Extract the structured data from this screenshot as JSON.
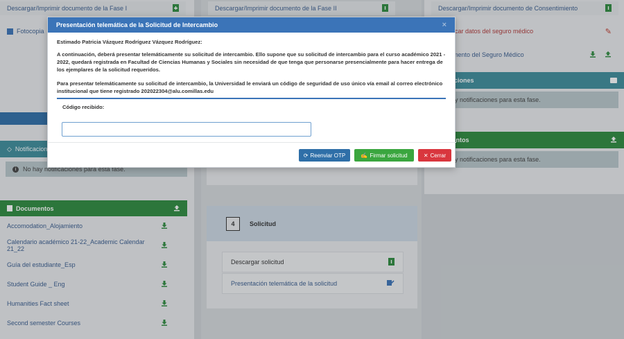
{
  "left_column": {
    "fase1_download": "Descargar/Imprimir documento de la Fase I",
    "fotocopia": "Fotocopia",
    "notifications_header": "Notificaciones",
    "no_notifications": "No hay notificaciones para esta fase.",
    "documents_header": "Documentos",
    "documents": [
      "Accomodation_Alojamiento",
      "Calendario académico 21-22_Academic Calendar 21_22",
      "Guía del estudiante_Esp",
      "Student Guide _ Eng",
      "Humanities Fact sheet",
      "Second semester Courses"
    ]
  },
  "middle_column": {
    "fase2_download": "Descargar/Imprimir documento de la Fase II",
    "step_number": "4",
    "step_title": "Solicitud",
    "download_solicitud": "Descargar solicitud",
    "presentacion_telematica": "Presentación telemática de la solicitud"
  },
  "right_column": {
    "consent_download": "Descargar/Imprimir documento de Consentimiento",
    "modify_insurance": "Modificar datos del seguro médico",
    "insurance_doc": "Documento del Seguro Médico",
    "notifications_header": "Notificaciones",
    "no_notifications": "No hay notificaciones para esta fase.",
    "documents_header": "Documentos",
    "no_notifications_2": "No hay notificaciones para esta fase."
  },
  "modal": {
    "title": "Presentación telemática de la Solicitud de Intercambio",
    "greeting": "Estimado Patricia Vázquez Rodríguez Vázquez Rodríguez:",
    "paragraph1": "A continuación, deberá presentar telemáticamente su solicitud de intercambio. Ello supone que su solicitud de intercambio para el curso académico 2021 - 2022, quedará registrada en Facultad de Ciencias Humanas y Sociales sin necesidad de que tenga que personarse presencialmente para hacer entrega de los ejemplares de la solicitud requeridos.",
    "paragraph2": "Para presentar telemáticamente su solicitud de intercambio, la Universidad le enviará un código de seguridad de uso único vía email al correo electrónico institucional que tiene registrado 202022304@alu.comillas.edu",
    "code_label": "Código recibido:",
    "code_value": "",
    "resend_label": "Reenviar OTP",
    "sign_label": "Firmar solicitud",
    "close_label": "Cerrar",
    "close_x": "×"
  },
  "colors": {
    "modal_header": "#3b74b8",
    "resend_btn": "#2f6fa8",
    "sign_btn": "#3aa63f",
    "close_btn": "#d9363e",
    "green_header": "#2e8b3e",
    "teal_header": "#3e8e9c"
  }
}
